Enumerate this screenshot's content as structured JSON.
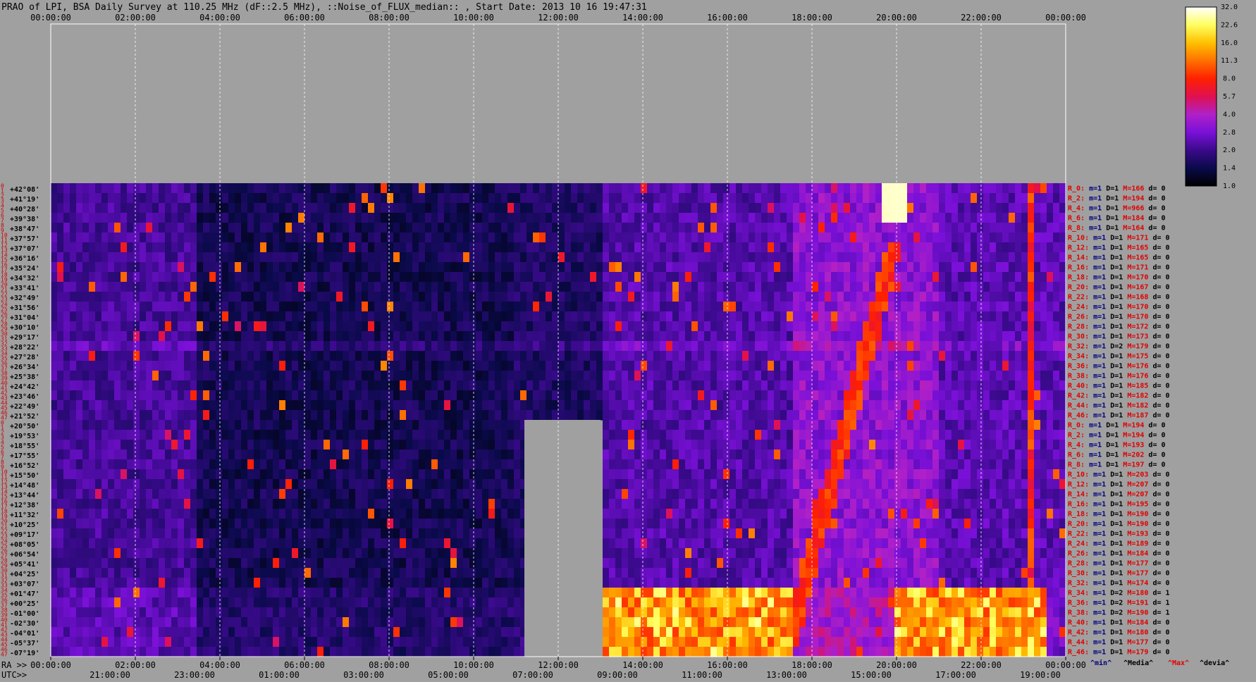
{
  "title": "PRAO of LPI, BSA Daily Survey at 110.25 MHz (dF::2.5 MHz), ::Noise_of_FLUX_median:: , Start Date: 2013 10 16 19:47:31",
  "top_axis_ticks": [
    "00:00:00",
    "02:00:00",
    "04:00:00",
    "06:00:00",
    "08:00:00",
    "10:00:00",
    "12:00:00",
    "14:00:00",
    "16:00:00",
    "18:00:00",
    "20:00:00",
    "22:00:00",
    "00:00:00"
  ],
  "ra_label": "RA >>",
  "utc_label": "UTC>>",
  "ra_ticks": [
    "00:00:00",
    "02:00:00",
    "04:00:00",
    "06:00:00",
    "08:00:00",
    "10:00:00",
    "12:00:00",
    "14:00:00",
    "16:00:00",
    "18:00:00",
    "20:00:00",
    "22:00:00",
    "00:00:00"
  ],
  "utc_ticks": [
    "21:00:00",
    "23:00:00",
    "01:00:00",
    "03:00:00",
    "05:00:00",
    "07:00:00",
    "09:00:00",
    "11:00:00",
    "13:00:00",
    "15:00:00",
    "17:00:00",
    "19:00:00"
  ],
  "dec_labels": [
    "+42°08'",
    "+41°19'",
    "+40°28'",
    "+39°38'",
    "+38°47'",
    "+37°57'",
    "+37°07'",
    "+36°16'",
    "+35°24'",
    "+34°32'",
    "+33°41'",
    "+32°49'",
    "+31°56'",
    "+31°04'",
    "+30°10'",
    "+29°17'",
    "+28°22'",
    "+27°28'",
    "+26°34'",
    "+25°38'",
    "+24°42'",
    "+23°46'",
    "+22°49'",
    "+21°52'",
    "+20°50'",
    "+19°53'",
    "+18°55'",
    "+17°55'",
    "+16°52'",
    "+15°50'",
    "+14°48'",
    "+13°44'",
    "+12°38'",
    "+11°32'",
    "+10°25'",
    "+09°17'",
    "+08°05'",
    "+06°54'",
    "+05°41'",
    "+04°25'",
    "+03°07'",
    "+01°47'",
    "+00°25'",
    "-01°00'",
    "-02°30'",
    "-04°01'",
    "-05°37'",
    "-07°19'"
  ],
  "row_indices": [
    "0",
    "1",
    "2",
    "3",
    "4",
    "5",
    "6",
    "7",
    "8",
    "9",
    "10",
    "11",
    "12",
    "13",
    "14",
    "15",
    "16",
    "17",
    "18",
    "19",
    "20",
    "21",
    "22",
    "23",
    "24",
    "25",
    "26",
    "27",
    "28",
    "29",
    "30",
    "31",
    "32",
    "33",
    "34",
    "35",
    "36",
    "37",
    "38",
    "39",
    "40",
    "41",
    "42",
    "43",
    "44",
    "45",
    "46",
    "47",
    "0",
    "1",
    "2",
    "3",
    "4",
    "5",
    "6",
    "7",
    "8",
    "9",
    "10",
    "11",
    "12",
    "13",
    "14",
    "15",
    "16",
    "17",
    "18",
    "19",
    "20",
    "21",
    "22",
    "23",
    "24",
    "25",
    "26",
    "27",
    "28",
    "29",
    "30",
    "31",
    "32",
    "33",
    "34",
    "35",
    "36",
    "37",
    "38",
    "39",
    "40",
    "41",
    "42",
    "43",
    "44",
    "45",
    "46",
    "47"
  ],
  "row_stats": [
    {
      "r": "R_0:",
      "m": "m=1",
      "d": "D=1",
      "max": "M=166",
      "dv": "d= 0"
    },
    {
      "r": "R_2:",
      "m": "m=1",
      "d": "D=1",
      "max": "M=194",
      "dv": "d= 0"
    },
    {
      "r": "R_4:",
      "m": "m=1",
      "d": "D=1",
      "max": "M=966",
      "dv": "d= 0"
    },
    {
      "r": "R_6:",
      "m": "m=1",
      "d": "D=1",
      "max": "M=184",
      "dv": "d= 0"
    },
    {
      "r": "R_8:",
      "m": "m=1",
      "d": "D=1",
      "max": "M=164",
      "dv": "d= 0"
    },
    {
      "r": "R_10:",
      "m": "m=1",
      "d": "D=1",
      "max": "M=171",
      "dv": "d= 0"
    },
    {
      "r": "R_12:",
      "m": "m=1",
      "d": "D=1",
      "max": "M=165",
      "dv": "d= 0"
    },
    {
      "r": "R_14:",
      "m": "m=1",
      "d": "D=1",
      "max": "M=165",
      "dv": "d= 0"
    },
    {
      "r": "R_16:",
      "m": "m=1",
      "d": "D=1",
      "max": "M=171",
      "dv": "d= 0"
    },
    {
      "r": "R_18:",
      "m": "m=1",
      "d": "D=1",
      "max": "M=170",
      "dv": "d= 0"
    },
    {
      "r": "R_20:",
      "m": "m=1",
      "d": "D=1",
      "max": "M=167",
      "dv": "d= 0"
    },
    {
      "r": "R_22:",
      "m": "m=1",
      "d": "D=1",
      "max": "M=168",
      "dv": "d= 0"
    },
    {
      "r": "R_24:",
      "m": "m=1",
      "d": "D=1",
      "max": "M=170",
      "dv": "d= 0"
    },
    {
      "r": "R_26:",
      "m": "m=1",
      "d": "D=1",
      "max": "M=170",
      "dv": "d= 0"
    },
    {
      "r": "R_28:",
      "m": "m=1",
      "d": "D=1",
      "max": "M=172",
      "dv": "d= 0"
    },
    {
      "r": "R_30:",
      "m": "m=1",
      "d": "D=1",
      "max": "M=173",
      "dv": "d= 0"
    },
    {
      "r": "R_32:",
      "m": "m=1",
      "d": "D=2",
      "max": "M=179",
      "dv": "d= 0"
    },
    {
      "r": "R_34:",
      "m": "m=1",
      "d": "D=1",
      "max": "M=175",
      "dv": "d= 0"
    },
    {
      "r": "R_36:",
      "m": "m=1",
      "d": "D=1",
      "max": "M=176",
      "dv": "d= 0"
    },
    {
      "r": "R_38:",
      "m": "m=1",
      "d": "D=1",
      "max": "M=176",
      "dv": "d= 0"
    },
    {
      "r": "R_40:",
      "m": "m=1",
      "d": "D=1",
      "max": "M=185",
      "dv": "d= 0"
    },
    {
      "r": "R_42:",
      "m": "m=1",
      "d": "D=1",
      "max": "M=182",
      "dv": "d= 0"
    },
    {
      "r": "R_44:",
      "m": "m=1",
      "d": "D=1",
      "max": "M=182",
      "dv": "d= 0"
    },
    {
      "r": "R_46:",
      "m": "m=1",
      "d": "D=1",
      "max": "M=187",
      "dv": "d= 0"
    },
    {
      "r": "R_0:",
      "m": "m=1",
      "d": "D=1",
      "max": "M=194",
      "dv": "d= 0"
    },
    {
      "r": "R_2:",
      "m": "m=1",
      "d": "D=1",
      "max": "M=194",
      "dv": "d= 0"
    },
    {
      "r": "R_4:",
      "m": "m=1",
      "d": "D=1",
      "max": "M=193",
      "dv": "d= 0"
    },
    {
      "r": "R_6:",
      "m": "m=1",
      "d": "D=1",
      "max": "M=202",
      "dv": "d= 0"
    },
    {
      "r": "R_8:",
      "m": "m=1",
      "d": "D=1",
      "max": "M=197",
      "dv": "d= 0"
    },
    {
      "r": "R_10:",
      "m": "m=1",
      "d": "D=1",
      "max": "M=203",
      "dv": "d= 0"
    },
    {
      "r": "R_12:",
      "m": "m=1",
      "d": "D=1",
      "max": "M=207",
      "dv": "d= 0"
    },
    {
      "r": "R_14:",
      "m": "m=1",
      "d": "D=1",
      "max": "M=207",
      "dv": "d= 0"
    },
    {
      "r": "R_16:",
      "m": "m=1",
      "d": "D=1",
      "max": "M=195",
      "dv": "d= 0"
    },
    {
      "r": "R_18:",
      "m": "m=1",
      "d": "D=1",
      "max": "M=190",
      "dv": "d= 0"
    },
    {
      "r": "R_20:",
      "m": "m=1",
      "d": "D=1",
      "max": "M=190",
      "dv": "d= 0"
    },
    {
      "r": "R_22:",
      "m": "m=1",
      "d": "D=1",
      "max": "M=193",
      "dv": "d= 0"
    },
    {
      "r": "R_24:",
      "m": "m=1",
      "d": "D=1",
      "max": "M=189",
      "dv": "d= 0"
    },
    {
      "r": "R_26:",
      "m": "m=1",
      "d": "D=1",
      "max": "M=184",
      "dv": "d= 0"
    },
    {
      "r": "R_28:",
      "m": "m=1",
      "d": "D=1",
      "max": "M=177",
      "dv": "d= 0"
    },
    {
      "r": "R_30:",
      "m": "m=1",
      "d": "D=1",
      "max": "M=177",
      "dv": "d= 0"
    },
    {
      "r": "R_32:",
      "m": "m=1",
      "d": "D=1",
      "max": "M=174",
      "dv": "d= 0"
    },
    {
      "r": "R_34:",
      "m": "m=1",
      "d": "D=2",
      "max": "M=180",
      "dv": "d= 1"
    },
    {
      "r": "R_36:",
      "m": "m=1",
      "d": "D=2",
      "max": "M=191",
      "dv": "d= 1"
    },
    {
      "r": "R_38:",
      "m": "m=1",
      "d": "D=2",
      "max": "M=190",
      "dv": "d= 1"
    },
    {
      "r": "R_40:",
      "m": "m=1",
      "d": "D=1",
      "max": "M=184",
      "dv": "d= 0"
    },
    {
      "r": "R_42:",
      "m": "m=1",
      "d": "D=1",
      "max": "M=180",
      "dv": "d= 0"
    },
    {
      "r": "R_44:",
      "m": "m=1",
      "d": "D=1",
      "max": "M=177",
      "dv": "d= 0"
    },
    {
      "r": "R_46:",
      "m": "m=1",
      "d": "D=1",
      "max": "M=179",
      "dv": "d= 0"
    }
  ],
  "stat_footer": {
    "min": "^min^",
    "media": "^Media^",
    "max": "^Max^",
    "devia": "^devia^"
  },
  "colorbar": {
    "labels": [
      "32.0",
      "22.6",
      "16.0",
      "11.3",
      "8.0",
      "5.7",
      "4.0",
      "2.8",
      "2.0",
      "1.4",
      "1.0"
    ],
    "colors": [
      "#000000",
      "#0a0a4a",
      "#3a0a8a",
      "#7a10d8",
      "#b020c8",
      "#e01050",
      "#ff2000",
      "#ff7000",
      "#ffc000",
      "#ffff60",
      "#ffffff"
    ]
  },
  "chart_data": {
    "type": "heatmap",
    "title": "PRAO of LPI, BSA Daily Survey at 110.25 MHz (dF::2.5 MHz), ::Noise_of_FLUX_median:: , Start Date: 2013 10 16 19:47:31",
    "x_axis": "RA 00:00:00 to 00:00:00 (24 h)",
    "y_axis": "Declination +42°08' to -07°19'",
    "colorscale_range": [
      1.0,
      32.0
    ],
    "colorscale": "log",
    "note_regions": [
      {
        "feature": "data gap",
        "ra_hours": [
          11.2,
          13.0
        ],
        "dec_rows": [
          24,
          47
        ]
      },
      {
        "feature": "bright horizontal band",
        "ra_hours": [
          13.1,
          17.6
        ],
        "dec_rows": [
          41,
          47
        ]
      },
      {
        "feature": "bright horizontal band",
        "ra_hours": [
          20.0,
          23.5
        ],
        "dec_rows": [
          41,
          47
        ]
      },
      {
        "feature": "bright source",
        "ra_hours": [
          19.9,
          20.0
        ],
        "dec_rows": [
          1,
          3
        ]
      }
    ]
  }
}
